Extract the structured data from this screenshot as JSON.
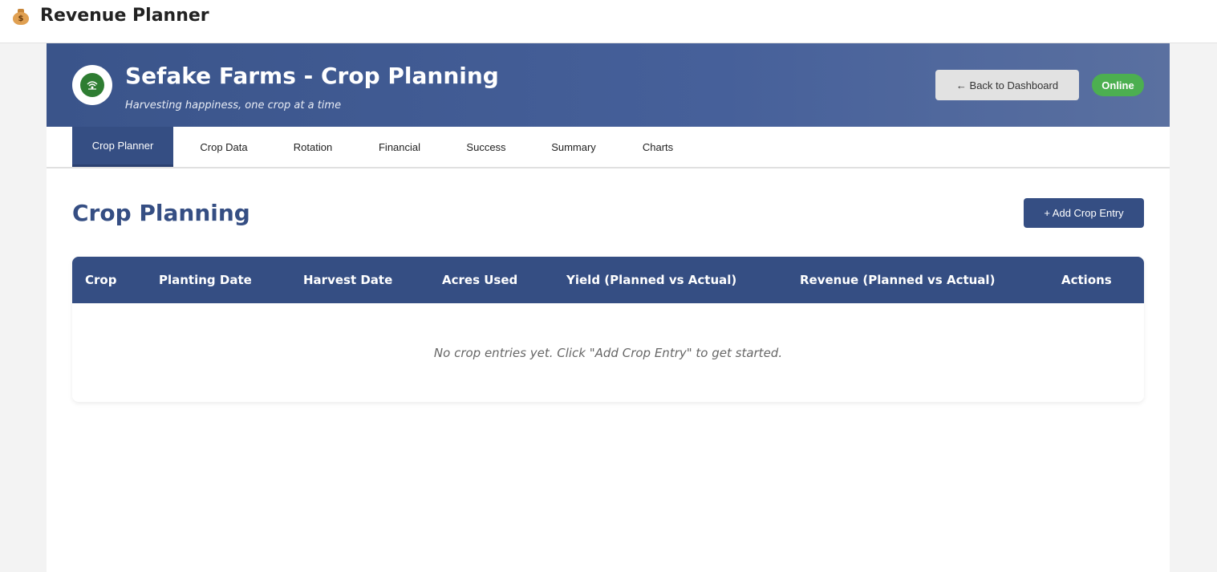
{
  "app": {
    "icon": "money-bag-icon",
    "icon_glyph": "$",
    "title": "Revenue Planner"
  },
  "hero": {
    "logo_icon": "farm-logo-icon",
    "title": "Sefake Farms - Crop Planning",
    "tagline": "Harvesting happiness, one crop at a time",
    "back_label": "← Back to Dashboard",
    "status": "Online",
    "status_color": "#4caf50"
  },
  "tabs": [
    {
      "label": "Crop Planner",
      "active": true
    },
    {
      "label": "Crop Data",
      "active": false
    },
    {
      "label": "Rotation",
      "active": false
    },
    {
      "label": "Financial",
      "active": false
    },
    {
      "label": "Success",
      "active": false
    },
    {
      "label": "Summary",
      "active": false
    },
    {
      "label": "Charts",
      "active": false
    }
  ],
  "main": {
    "title": "Crop Planning",
    "add_label": "+ Add Crop Entry"
  },
  "table": {
    "columns": [
      "Crop",
      "Planting Date",
      "Harvest Date",
      "Acres Used",
      "Yield (Planned vs Actual)",
      "Revenue (Planned vs Actual)",
      "Actions"
    ],
    "empty_message": "No crop entries yet. Click \"Add Crop Entry\" to get started."
  },
  "colors": {
    "primary": "#354e83",
    "accent_green": "#2e7d32"
  }
}
